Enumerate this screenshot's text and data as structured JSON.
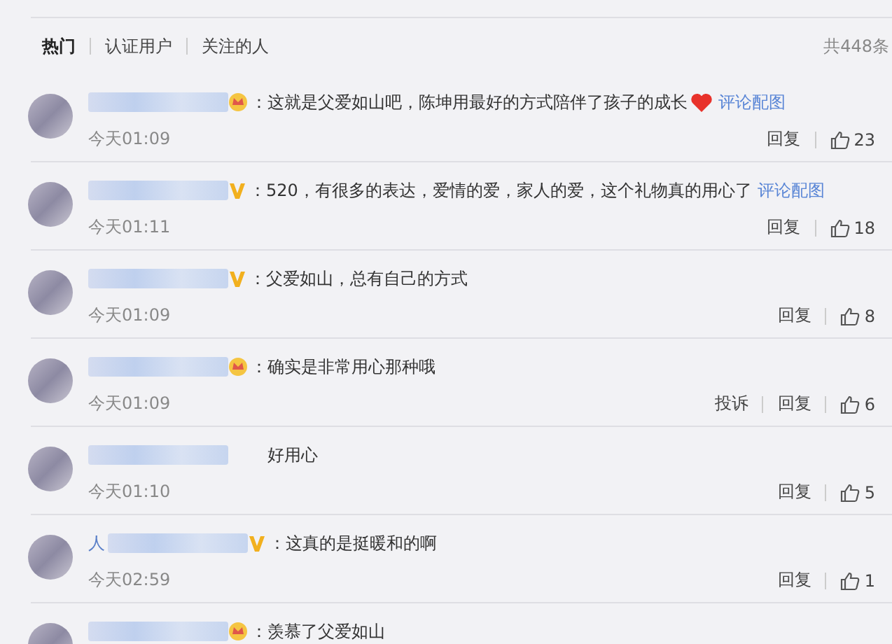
{
  "tabs": [
    {
      "label": "热门",
      "selected": true
    },
    {
      "label": "认证用户",
      "selected": false
    },
    {
      "label": "关注的人",
      "selected": false
    }
  ],
  "total": "共448条",
  "comments": [
    {
      "kind": "crown",
      "text": "：这就是父爱如山吧，陈坤用最好的方式陪伴了孩子的成长",
      "heart": true,
      "link": "评论配图",
      "time": "今天01:09",
      "actions": [
        "回复"
      ],
      "likes": "23"
    },
    {
      "kind": "vip",
      "text": "：520，有很多的表达，爱情的爱，家人的爱，这个礼物真的用心了",
      "heart": false,
      "link": "评论配图",
      "time": "今天01:11",
      "actions": [
        "回复"
      ],
      "likes": "18"
    },
    {
      "kind": "vip",
      "text": "：父爱如山，总有自己的方式",
      "heart": false,
      "time": "今天01:09",
      "actions": [
        "回复"
      ],
      "likes": "8"
    },
    {
      "kind": "crown",
      "text": "：确实是非常用心那种哦",
      "heart": false,
      "time": "今天01:09",
      "actions": [
        "投诉",
        "回复"
      ],
      "likes": "6"
    },
    {
      "kind": "plain",
      "text": "好用心",
      "heart": false,
      "time": "今天01:10",
      "actions": [
        "回复"
      ],
      "likes": "5"
    },
    {
      "kind": "vip",
      "name_visible": "人",
      "text": "：这真的是挺暖和的啊",
      "heart": false,
      "time": "今天02:59",
      "actions": [
        "回复"
      ],
      "likes": "1"
    },
    {
      "kind": "crown",
      "text": "：羡慕了父爱如山",
      "heart": false
    }
  ]
}
